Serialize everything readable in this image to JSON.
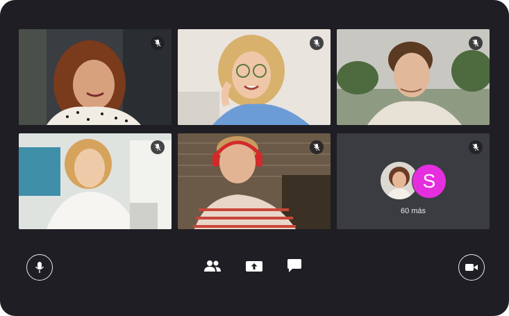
{
  "participants": [
    {
      "id": "p1",
      "muted": true
    },
    {
      "id": "p2",
      "muted": true
    },
    {
      "id": "p3",
      "muted": true
    },
    {
      "id": "p4",
      "muted": true
    },
    {
      "id": "p5",
      "muted": true
    }
  ],
  "overflow": {
    "avatar_letter": "S",
    "label": "60 más",
    "letter_color": "#e52fde"
  },
  "controls": {
    "left": {
      "icon": "microphone-icon"
    },
    "center": [
      {
        "icon": "people-icon"
      },
      {
        "icon": "share-screen-icon"
      },
      {
        "icon": "chat-icon"
      }
    ],
    "right": {
      "icon": "video-camera-icon"
    }
  },
  "colors": {
    "background": "#1f1e24",
    "tile_empty": "#3b3c41",
    "icon": "#ffffff"
  }
}
